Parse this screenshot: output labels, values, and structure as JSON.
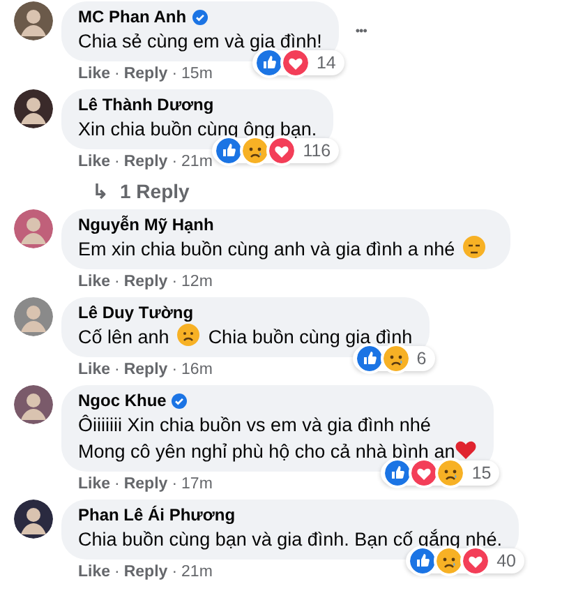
{
  "comments": [
    {
      "name": "MC Phan Anh",
      "verified": true,
      "more_menu": "•••",
      "lines": [
        [
          {
            "kind": "text",
            "text": "Chia sẻ cùng em và gia đình!"
          }
        ]
      ],
      "reactions": [
        {
          "kind": "like"
        },
        {
          "kind": "love"
        }
      ],
      "count": "14",
      "actions": [
        "Like",
        "Reply"
      ],
      "separator": "·",
      "time": "15m"
    },
    {
      "name": "Lê Thành Dương",
      "verified": false,
      "lines": [
        [
          {
            "kind": "text",
            "text": "Xin chia buồn cùng ông bạn."
          }
        ]
      ],
      "reactions": [
        {
          "kind": "like"
        },
        {
          "kind": "sad"
        },
        {
          "kind": "love"
        }
      ],
      "count": "116",
      "actions": [
        "Like",
        "Reply"
      ],
      "separator": "·",
      "time": "21m",
      "replies": {
        "arrow": "↳",
        "label": "1 Reply"
      }
    },
    {
      "name": "Nguyễn Mỹ Hạnh",
      "verified": false,
      "lines": [
        [
          {
            "kind": "text",
            "text": "Em xin chia buồn cùng anh và gia đình a nhé"
          },
          {
            "kind": "pensive"
          }
        ]
      ],
      "actions": [
        "Like",
        "Reply"
      ],
      "separator": "·",
      "time": "12m"
    },
    {
      "name": "Lê Duy Tường",
      "verified": false,
      "lines": [
        [
          {
            "kind": "text",
            "text": "Cố lên anh"
          },
          {
            "kind": "frown"
          },
          {
            "kind": "text",
            "text": "Chia buồn cùng gia đình"
          }
        ]
      ],
      "reactions": [
        {
          "kind": "like"
        },
        {
          "kind": "sad"
        }
      ],
      "count": "6",
      "actions": [
        "Like",
        "Reply"
      ],
      "separator": "·",
      "time": "16m"
    },
    {
      "name": "Ngoc Khue",
      "verified": true,
      "lines": [
        [
          {
            "kind": "text",
            "text": "Ôiiiiiii Xin chia buồn vs em và gia đình nhé"
          }
        ],
        [
          {
            "kind": "text",
            "text": "Mong cô yên nghỉ phù hộ cho cả nhà bình an"
          },
          {
            "kind": "heart"
          }
        ]
      ],
      "reactions": [
        {
          "kind": "like"
        },
        {
          "kind": "love"
        },
        {
          "kind": "sad"
        }
      ],
      "count": "15",
      "actions": [
        "Like",
        "Reply"
      ],
      "separator": "·",
      "time": "17m"
    },
    {
      "name": "Phan Lê Ái Phương",
      "verified": false,
      "lines": [
        [
          {
            "kind": "text",
            "text": "Chia buồn cùng bạn và gia đình. Bạn cố gắng nhé."
          }
        ]
      ],
      "reactions": [
        {
          "kind": "like"
        },
        {
          "kind": "sad"
        },
        {
          "kind": "love"
        }
      ],
      "count": "40",
      "actions": [
        "Like",
        "Reply"
      ],
      "separator": "·",
      "time": "21m"
    }
  ]
}
